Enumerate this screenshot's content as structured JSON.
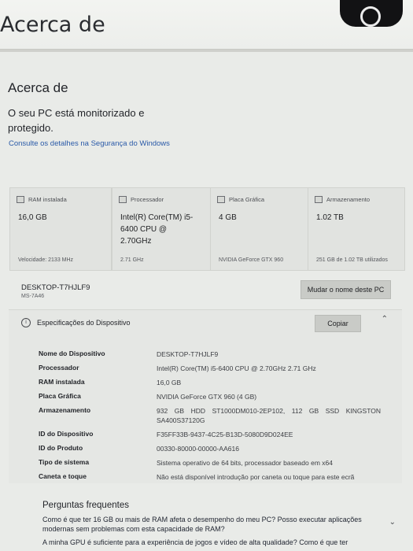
{
  "background_window": {
    "title": "Acerca de"
  },
  "page": {
    "title": "Acerca de",
    "protection_text": "O seu PC está monitorizado e protegido.",
    "security_link": "Consulte os detalhes na Segurança do Windows"
  },
  "cards": [
    {
      "icon": "ram-icon",
      "label": "RAM instalada",
      "value": "16,0 GB",
      "sub": "Velocidade: 2133 MHz"
    },
    {
      "icon": "processor-icon",
      "label": "Processador",
      "value": "Intel(R) Core(TM) i5-6400 CPU @ 2.70GHz",
      "sub": "2.71 GHz"
    },
    {
      "icon": "graphics-card-icon",
      "label": "Placa Gráfica",
      "value": "4 GB",
      "sub": "NVIDIA GeForce GTX 960"
    },
    {
      "icon": "storage-icon",
      "label": "Armazenamento",
      "value": "1.02 TB",
      "sub": "251 GB de 1.02 TB utilizados"
    }
  ],
  "pc": {
    "name": "DESKTOP-T7HJLF9",
    "model": "MS-7A46",
    "rename_button": "Mudar o nome deste PC"
  },
  "specs": {
    "title": "Especificações do Dispositivo",
    "copy_button": "Copiar",
    "rows": [
      {
        "label": "Nome do Dispositivo",
        "value": "DESKTOP-T7HJLF9"
      },
      {
        "label": "Processador",
        "value": "Intel(R) Core(TM) i5-6400 CPU @ 2.70GHz   2.71 GHz"
      },
      {
        "label": "RAM instalada",
        "value": "16,0 GB"
      },
      {
        "label": "Placa Gráfica",
        "value": "NVIDIA GeForce GTX 960 (4 GB)"
      },
      {
        "label": "Armazenamento",
        "value": "932 GB HDD ST1000DM010-2EP102, 112 GB SSD KINGSTON SA400S37120G"
      },
      {
        "label": "ID do Dispositivo",
        "value": "F35FF33B-9437-4C25-B13D-5080D9D024EE"
      },
      {
        "label": "ID do Produto",
        "value": "00330-80000-00000-AA616"
      },
      {
        "label": "Tipo de sistema",
        "value": "Sistema operativo de 64 bits, processador baseado em x64"
      },
      {
        "label": "Caneta e toque",
        "value": "Não está disponível introdução por caneta ou toque para este ecrã"
      }
    ]
  },
  "faq": {
    "title": "Perguntas frequentes",
    "items": [
      "Como é que ter 16 GB ou mais de RAM afeta o desempenho do meu PC? Posso executar aplicações modernas sem problemas com esta capacidade de RAM?",
      "A minha GPU é suficiente para a experiência de jogos e vídeo de alta qualidade? Como é que ter"
    ]
  }
}
